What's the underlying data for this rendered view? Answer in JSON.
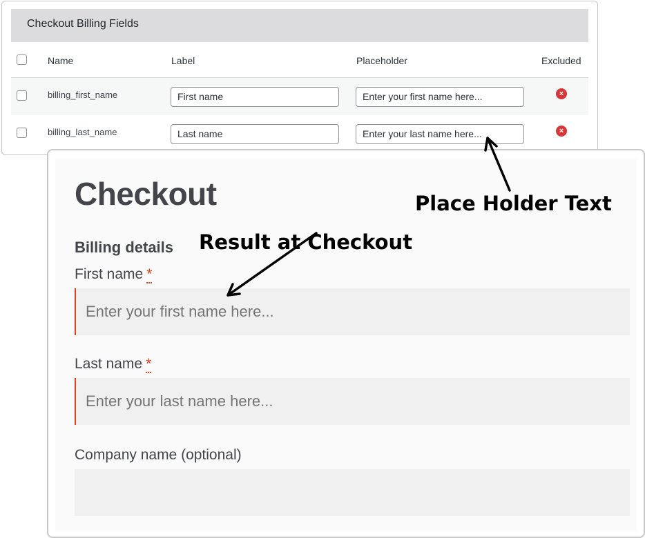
{
  "admin": {
    "title": "Checkout Billing Fields",
    "columns": {
      "name": "Name",
      "label": "Label",
      "placeholder": "Placeholder",
      "excluded": "Excluded"
    },
    "rows": [
      {
        "name": "billing_first_name",
        "label": "First name",
        "placeholder": "Enter your first name here...",
        "excluded": "×"
      },
      {
        "name": "billing_last_name",
        "label": "Last name",
        "placeholder": "Enter your last name here...",
        "excluded": "×"
      }
    ]
  },
  "checkout": {
    "title": "Checkout",
    "section": "Billing details",
    "fields": [
      {
        "label": "First name",
        "required_mark": "*",
        "placeholder": "Enter your first name here..."
      },
      {
        "label": "Last name",
        "required_mark": "*",
        "placeholder": "Enter your last name here..."
      },
      {
        "label": "Company name (optional)",
        "placeholder": ""
      }
    ]
  },
  "annotations": {
    "placeholder_text": "Place Holder Text",
    "result_at_checkout": "Result at Checkout"
  },
  "colors": {
    "required": "#e2401c",
    "excluded_icon": "#d63638",
    "admin_header_bg": "#dcdcde"
  }
}
